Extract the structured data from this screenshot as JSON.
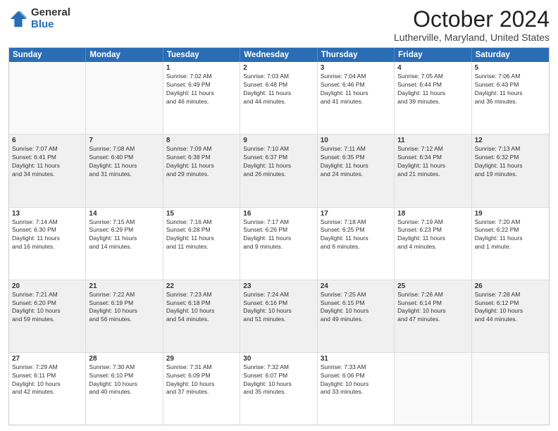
{
  "logo": {
    "general": "General",
    "blue": "Blue"
  },
  "header": {
    "month": "October 2024",
    "location": "Lutherville, Maryland, United States"
  },
  "weekdays": [
    "Sunday",
    "Monday",
    "Tuesday",
    "Wednesday",
    "Thursday",
    "Friday",
    "Saturday"
  ],
  "rows": [
    [
      {
        "day": "",
        "empty": true,
        "lines": []
      },
      {
        "day": "",
        "empty": true,
        "lines": []
      },
      {
        "day": "1",
        "lines": [
          "Sunrise: 7:02 AM",
          "Sunset: 6:49 PM",
          "Daylight: 11 hours",
          "and 46 minutes."
        ]
      },
      {
        "day": "2",
        "lines": [
          "Sunrise: 7:03 AM",
          "Sunset: 6:48 PM",
          "Daylight: 11 hours",
          "and 44 minutes."
        ]
      },
      {
        "day": "3",
        "lines": [
          "Sunrise: 7:04 AM",
          "Sunset: 6:46 PM",
          "Daylight: 11 hours",
          "and 41 minutes."
        ]
      },
      {
        "day": "4",
        "lines": [
          "Sunrise: 7:05 AM",
          "Sunset: 6:44 PM",
          "Daylight: 11 hours",
          "and 39 minutes."
        ]
      },
      {
        "day": "5",
        "lines": [
          "Sunrise: 7:06 AM",
          "Sunset: 6:43 PM",
          "Daylight: 11 hours",
          "and 36 minutes."
        ]
      }
    ],
    [
      {
        "day": "6",
        "shaded": true,
        "lines": [
          "Sunrise: 7:07 AM",
          "Sunset: 6:41 PM",
          "Daylight: 11 hours",
          "and 34 minutes."
        ]
      },
      {
        "day": "7",
        "shaded": true,
        "lines": [
          "Sunrise: 7:08 AM",
          "Sunset: 6:40 PM",
          "Daylight: 11 hours",
          "and 31 minutes."
        ]
      },
      {
        "day": "8",
        "shaded": true,
        "lines": [
          "Sunrise: 7:09 AM",
          "Sunset: 6:38 PM",
          "Daylight: 11 hours",
          "and 29 minutes."
        ]
      },
      {
        "day": "9",
        "shaded": true,
        "lines": [
          "Sunrise: 7:10 AM",
          "Sunset: 6:37 PM",
          "Daylight: 11 hours",
          "and 26 minutes."
        ]
      },
      {
        "day": "10",
        "shaded": true,
        "lines": [
          "Sunrise: 7:11 AM",
          "Sunset: 6:35 PM",
          "Daylight: 11 hours",
          "and 24 minutes."
        ]
      },
      {
        "day": "11",
        "shaded": true,
        "lines": [
          "Sunrise: 7:12 AM",
          "Sunset: 6:34 PM",
          "Daylight: 11 hours",
          "and 21 minutes."
        ]
      },
      {
        "day": "12",
        "shaded": true,
        "lines": [
          "Sunrise: 7:13 AM",
          "Sunset: 6:32 PM",
          "Daylight: 11 hours",
          "and 19 minutes."
        ]
      }
    ],
    [
      {
        "day": "13",
        "lines": [
          "Sunrise: 7:14 AM",
          "Sunset: 6:30 PM",
          "Daylight: 11 hours",
          "and 16 minutes."
        ]
      },
      {
        "day": "14",
        "lines": [
          "Sunrise: 7:15 AM",
          "Sunset: 6:29 PM",
          "Daylight: 11 hours",
          "and 14 minutes."
        ]
      },
      {
        "day": "15",
        "lines": [
          "Sunrise: 7:16 AM",
          "Sunset: 6:28 PM",
          "Daylight: 11 hours",
          "and 11 minutes."
        ]
      },
      {
        "day": "16",
        "lines": [
          "Sunrise: 7:17 AM",
          "Sunset: 6:26 PM",
          "Daylight: 11 hours",
          "and 9 minutes."
        ]
      },
      {
        "day": "17",
        "lines": [
          "Sunrise: 7:18 AM",
          "Sunset: 6:25 PM",
          "Daylight: 11 hours",
          "and 6 minutes."
        ]
      },
      {
        "day": "18",
        "lines": [
          "Sunrise: 7:19 AM",
          "Sunset: 6:23 PM",
          "Daylight: 11 hours",
          "and 4 minutes."
        ]
      },
      {
        "day": "19",
        "lines": [
          "Sunrise: 7:20 AM",
          "Sunset: 6:22 PM",
          "Daylight: 11 hours",
          "and 1 minute."
        ]
      }
    ],
    [
      {
        "day": "20",
        "shaded": true,
        "lines": [
          "Sunrise: 7:21 AM",
          "Sunset: 6:20 PM",
          "Daylight: 10 hours",
          "and 59 minutes."
        ]
      },
      {
        "day": "21",
        "shaded": true,
        "lines": [
          "Sunrise: 7:22 AM",
          "Sunset: 6:19 PM",
          "Daylight: 10 hours",
          "and 56 minutes."
        ]
      },
      {
        "day": "22",
        "shaded": true,
        "lines": [
          "Sunrise: 7:23 AM",
          "Sunset: 6:18 PM",
          "Daylight: 10 hours",
          "and 54 minutes."
        ]
      },
      {
        "day": "23",
        "shaded": true,
        "lines": [
          "Sunrise: 7:24 AM",
          "Sunset: 6:16 PM",
          "Daylight: 10 hours",
          "and 51 minutes."
        ]
      },
      {
        "day": "24",
        "shaded": true,
        "lines": [
          "Sunrise: 7:25 AM",
          "Sunset: 6:15 PM",
          "Daylight: 10 hours",
          "and 49 minutes."
        ]
      },
      {
        "day": "25",
        "shaded": true,
        "lines": [
          "Sunrise: 7:26 AM",
          "Sunset: 6:14 PM",
          "Daylight: 10 hours",
          "and 47 minutes."
        ]
      },
      {
        "day": "26",
        "shaded": true,
        "lines": [
          "Sunrise: 7:28 AM",
          "Sunset: 6:12 PM",
          "Daylight: 10 hours",
          "and 44 minutes."
        ]
      }
    ],
    [
      {
        "day": "27",
        "lines": [
          "Sunrise: 7:29 AM",
          "Sunset: 6:11 PM",
          "Daylight: 10 hours",
          "and 42 minutes."
        ]
      },
      {
        "day": "28",
        "lines": [
          "Sunrise: 7:30 AM",
          "Sunset: 6:10 PM",
          "Daylight: 10 hours",
          "and 40 minutes."
        ]
      },
      {
        "day": "29",
        "lines": [
          "Sunrise: 7:31 AM",
          "Sunset: 6:09 PM",
          "Daylight: 10 hours",
          "and 37 minutes."
        ]
      },
      {
        "day": "30",
        "lines": [
          "Sunrise: 7:32 AM",
          "Sunset: 6:07 PM",
          "Daylight: 10 hours",
          "and 35 minutes."
        ]
      },
      {
        "day": "31",
        "lines": [
          "Sunrise: 7:33 AM",
          "Sunset: 6:06 PM",
          "Daylight: 10 hours",
          "and 33 minutes."
        ]
      },
      {
        "day": "",
        "empty": true,
        "lines": []
      },
      {
        "day": "",
        "empty": true,
        "lines": []
      }
    ]
  ]
}
